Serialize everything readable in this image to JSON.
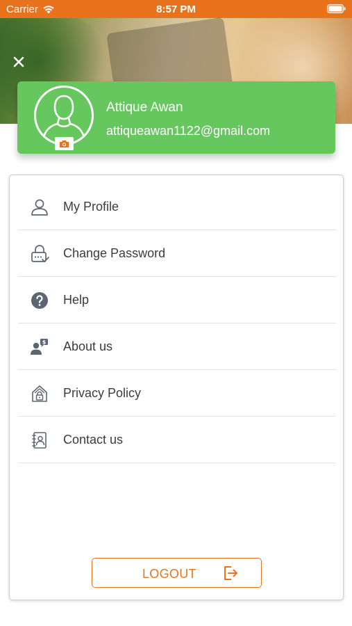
{
  "status_bar": {
    "carrier": "Carrier",
    "time": "8:57 PM"
  },
  "header": {
    "close_icon": "close-icon"
  },
  "profile": {
    "name": "Attique Awan",
    "email": "attiqueawan1122@gmail.com",
    "avatar_icon": "user-silhouette-icon",
    "camera_icon": "camera-icon"
  },
  "menu": {
    "items": [
      {
        "label": "My Profile",
        "icon": "user-icon"
      },
      {
        "label": "Change Password",
        "icon": "lock-icon"
      },
      {
        "label": "Help",
        "icon": "question-icon"
      },
      {
        "label": "About us",
        "icon": "about-icon"
      },
      {
        "label": "Privacy Policy",
        "icon": "privacy-icon"
      },
      {
        "label": "Contact us",
        "icon": "contacts-icon"
      }
    ]
  },
  "logout": {
    "label": "LOGOUT",
    "icon": "logout-icon"
  },
  "colors": {
    "accent_orange": "#e8731c",
    "profile_green": "#66c75e",
    "icon_gray": "#5c6670"
  }
}
